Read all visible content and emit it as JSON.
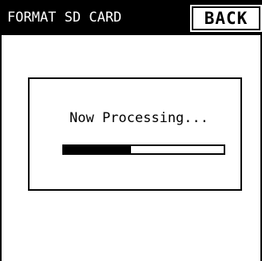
{
  "header": {
    "title": "FORMAT SD CARD",
    "back_label": "BACK"
  },
  "dialog": {
    "message": "Now Processing...",
    "progress": 0.42
  },
  "colors": {
    "header_bg": "#000000",
    "header_text": "#ffffff",
    "background": "#ffffff",
    "progress_fill": "#000000"
  }
}
